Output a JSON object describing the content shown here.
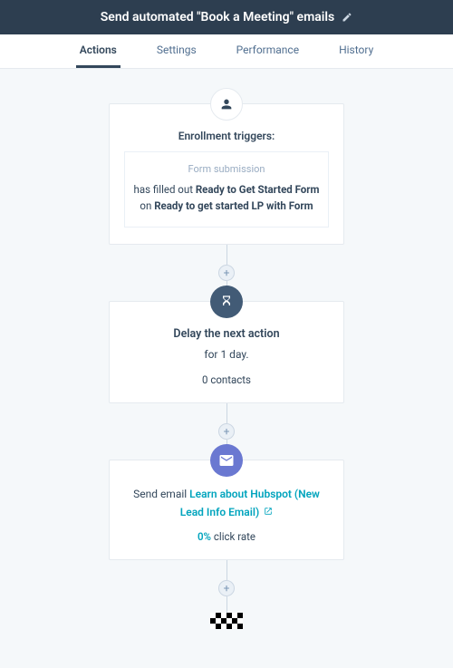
{
  "header": {
    "title": "Send automated \"Book a Meeting\" emails"
  },
  "tabs": {
    "actions": "Actions",
    "settings": "Settings",
    "performance": "Performance",
    "history": "History"
  },
  "enroll": {
    "heading": "Enrollment triggers:",
    "form_sub": "Form submission",
    "line1_prefix": "has filled out ",
    "line1_bold": "Ready to Get Started Form",
    "line2_prefix": "on ",
    "line2_bold": "Ready to get started LP with Form"
  },
  "delay": {
    "title": "Delay the next action",
    "for": "for 1 day.",
    "contacts": "0 contacts"
  },
  "email": {
    "prefix": "Send email ",
    "link": "Learn about Hubspot (New Lead Info Email)",
    "pct": "0%",
    "rate_label": " click rate"
  }
}
